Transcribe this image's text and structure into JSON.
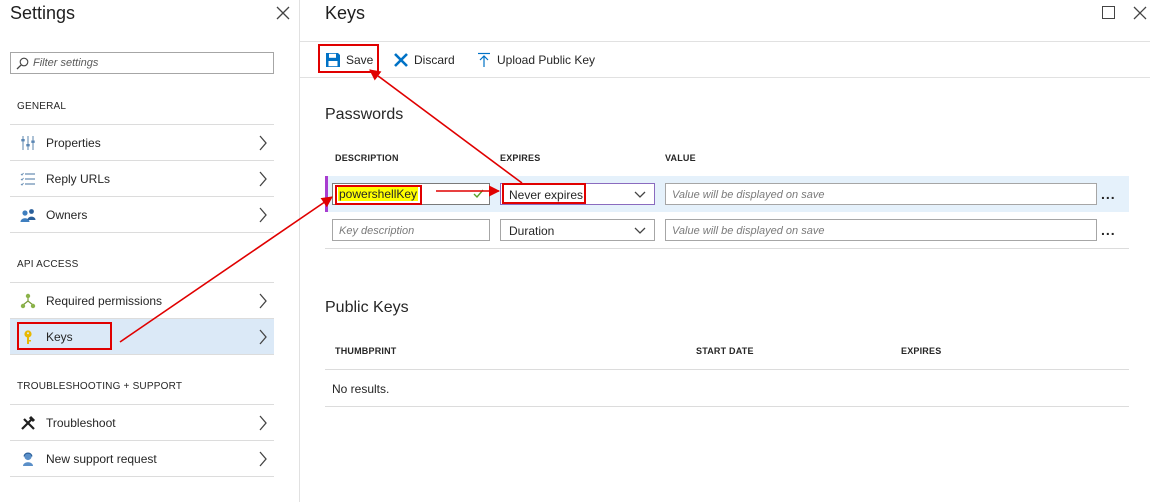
{
  "settings": {
    "title": "Settings",
    "filter_placeholder": "Filter settings",
    "sections": {
      "general": "GENERAL",
      "api_access": "API ACCESS",
      "troubleshooting": "TROUBLESHOOTING + SUPPORT"
    },
    "items": {
      "properties": "Properties",
      "reply_urls": "Reply URLs",
      "owners": "Owners",
      "required_permissions": "Required permissions",
      "keys": "Keys",
      "troubleshoot": "Troubleshoot",
      "new_support_request": "New support request"
    },
    "active_item": "Keys"
  },
  "keys": {
    "title": "Keys",
    "toolbar": {
      "save": "Save",
      "discard": "Discard",
      "upload_public_key": "Upload Public Key"
    },
    "passwords": {
      "heading": "Passwords",
      "columns": [
        "DESCRIPTION",
        "EXPIRES",
        "VALUE"
      ],
      "rows": [
        {
          "description": "powershellKey",
          "expires": "Never expires",
          "value_placeholder": "Value will be displayed on save",
          "ellipsis": "..."
        },
        {
          "description_placeholder": "Key description",
          "expires": "Duration",
          "value_placeholder": "Value will be displayed on save",
          "ellipsis": "..."
        }
      ]
    },
    "public_keys": {
      "heading": "Public Keys",
      "columns": [
        "THUMBPRINT",
        "START DATE",
        "EXPIRES"
      ],
      "empty_text": "No results."
    }
  },
  "colors": {
    "accent_blue": "#0072c6",
    "active_row_bg": "#dbe9f7",
    "annotation_red": "#e00000",
    "highlight_yellow": "#ffff00",
    "selected_row_marker": "#a83dd0"
  }
}
